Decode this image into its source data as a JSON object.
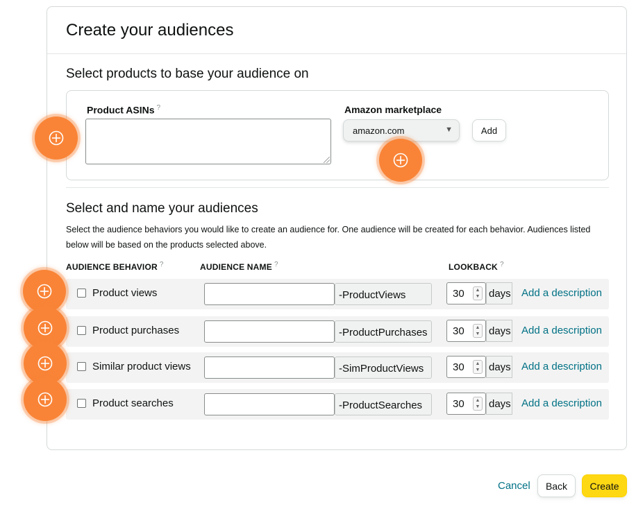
{
  "page_title": "Create your audiences",
  "products_section": {
    "title": "Select products to base your audience on",
    "asins_label": "Product ASINs",
    "asins_value": "",
    "help_mark": "?",
    "marketplace_label": "Amazon marketplace",
    "marketplace_value": "amazon.com",
    "add_button": "Add"
  },
  "audiences_section": {
    "title": "Select and name your audiences",
    "description": "Select the audience behaviors you would like to create an audience for. One audience will be created for each behavior. Audiences listed below will be based on the products selected above.",
    "col_behavior": "AUDIENCE BEHAVIOR",
    "col_name": "AUDIENCE NAME",
    "col_lookback": "LOOKBACK",
    "rows": [
      {
        "label": "Product views",
        "suffix": "-ProductViews",
        "lookback": "30",
        "unit": "days",
        "link": "Add a description"
      },
      {
        "label": "Product purchases",
        "suffix": "-ProductPurchases",
        "lookback": "30",
        "unit": "days",
        "link": "Add a description"
      },
      {
        "label": "Similar product views",
        "suffix": "-SimProductViews",
        "lookback": "30",
        "unit": "days",
        "link": "Add a description"
      },
      {
        "label": "Product searches",
        "suffix": "-ProductSearches",
        "lookback": "30",
        "unit": "days",
        "link": "Add a description"
      }
    ]
  },
  "footer": {
    "cancel": "Cancel",
    "back": "Back",
    "create": "Create"
  },
  "colors": {
    "hotspot": "#f98437",
    "link": "#007185",
    "primary": "#ffd814"
  }
}
